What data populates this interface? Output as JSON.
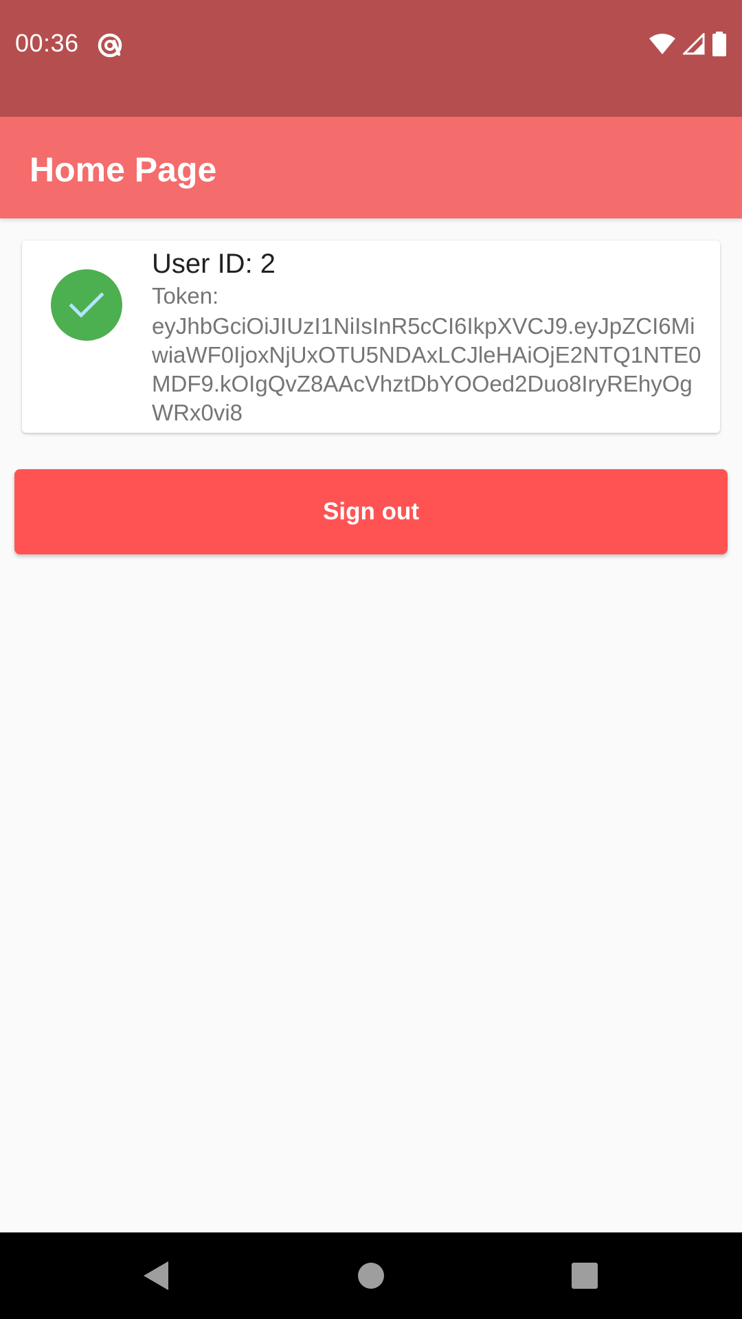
{
  "status_bar": {
    "time": "00:36",
    "left_icon": "at-sign-icon",
    "icons": [
      "wifi-icon",
      "cell-signal-icon",
      "battery-icon"
    ],
    "background": "#b54f4f"
  },
  "app_bar": {
    "title": "Home Page",
    "background": "#f46c6c"
  },
  "user_card": {
    "avatar_icon": "check-icon",
    "avatar_color": "#4caf50",
    "user_id": "User ID: 2",
    "token_label": "Token:",
    "token_value": "eyJhbGciOiJIUzI1NiIsInR5cCI6IkpXVCJ9.eyJpZCI6MiwiaWF0IjoxNjUxOTU5NDAxLCJleHAiOjE2NTQ1NTE0MDF9.kOIgQvZ8AAcVhztDbYOOed2Duo8IryREhyOgWRx0vi8"
  },
  "sign_out_button": {
    "label": "Sign out",
    "background": "#ff5353"
  },
  "nav_bar": {
    "buttons": [
      "back-icon",
      "home-icon",
      "recents-icon"
    ]
  }
}
